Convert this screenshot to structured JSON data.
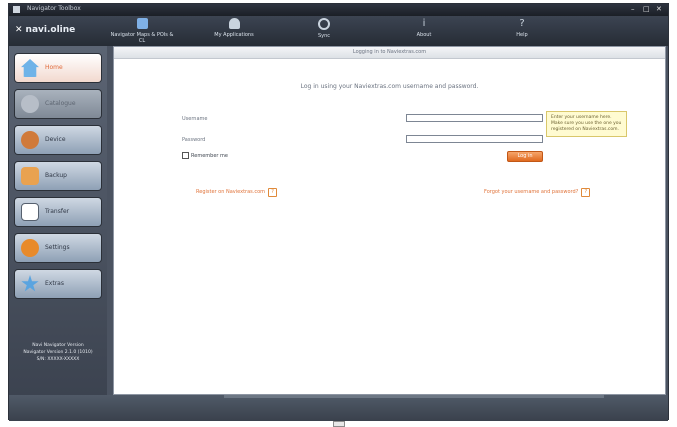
{
  "window": {
    "title": "Navigator Toolbox",
    "minimize": "–",
    "maximize": "□",
    "close": "✕"
  },
  "toolbar": {
    "logo_mark": "✕",
    "logo_text": "navi.oline",
    "buttons": [
      {
        "label": "Navigator Maps & POIs & CL",
        "icon": "map-icon",
        "color": "#7fb0e6"
      },
      {
        "label": "My Applications",
        "icon": "person-icon",
        "color": "#c9d3de"
      },
      {
        "label": "Sync",
        "icon": "sync-icon",
        "color": "#c9d3de"
      },
      {
        "label": "About",
        "icon": "info-icon",
        "color": "#c9d3de"
      },
      {
        "label": "Help",
        "icon": "help-icon",
        "color": "#c9d3de"
      }
    ]
  },
  "sidebar": {
    "items": [
      {
        "label": "Home",
        "icon": "home-icon",
        "active": true,
        "disabled": false,
        "color": "#6fb3e8"
      },
      {
        "label": "Catalogue",
        "icon": "catalogue-icon",
        "active": false,
        "disabled": true,
        "color": "#b7bec8"
      },
      {
        "label": "Device",
        "icon": "device-icon",
        "active": false,
        "disabled": false,
        "color": "#d07a3a"
      },
      {
        "label": "Backup",
        "icon": "backup-icon",
        "active": false,
        "disabled": false,
        "color": "#e9a250"
      },
      {
        "label": "Transfer",
        "icon": "transfer-icon",
        "active": false,
        "disabled": false,
        "color": "#ffffff"
      },
      {
        "label": "Settings",
        "icon": "settings-icon",
        "active": false,
        "disabled": false,
        "color": "#e88a2a"
      },
      {
        "label": "Extras",
        "icon": "star-icon",
        "active": false,
        "disabled": false,
        "color": "#5aa4e0"
      }
    ],
    "info_lines": [
      "Navi Navigator Version",
      "Navigator Version 2.1.0 (1010)",
      "S/N: XXXXX-XXXXX"
    ]
  },
  "main": {
    "breadcrumb": "Logging in to Naviextras.com",
    "intro": "Log in using your Naviextras.com username and password.",
    "username_label": "Username",
    "username_value": "",
    "password_label": "Password",
    "password_value": "",
    "tooltip": "Enter your username here. Make sure you use the one you registered on Naviextras.com.",
    "remember_label": "Remember me",
    "login_button": "Log in",
    "register_link": "Register on Naviextras.com",
    "forgot_link": "Forgot your username and password?",
    "help_glyph": "?"
  }
}
